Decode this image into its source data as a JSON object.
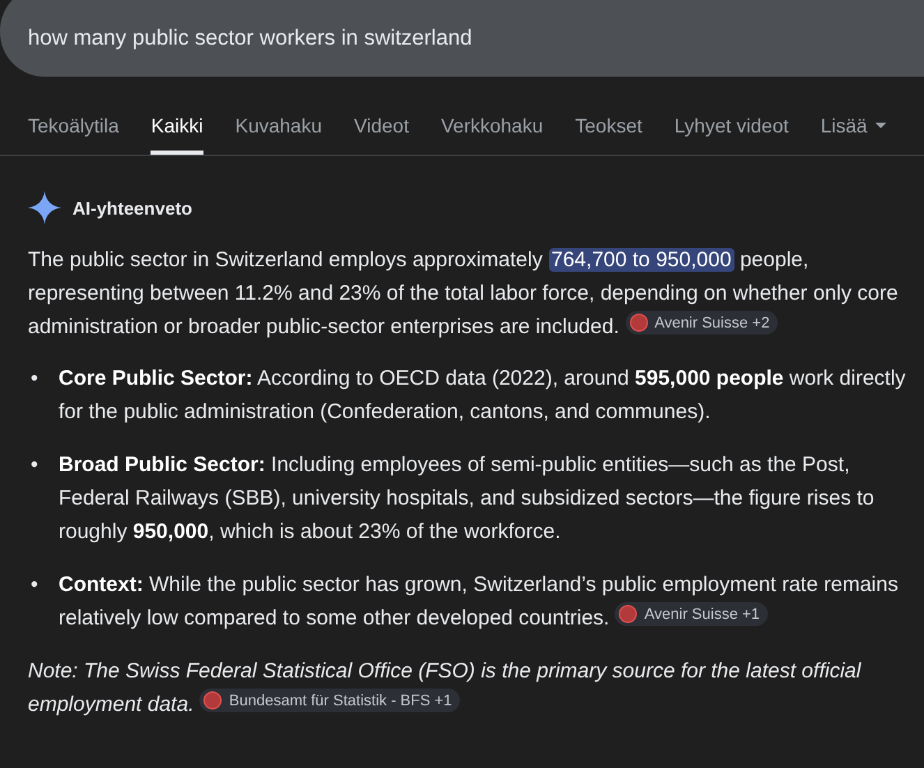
{
  "search": {
    "value": "how many public sector workers in switzerland"
  },
  "tabs": [
    {
      "label": "Tekoälytila",
      "selected": false
    },
    {
      "label": "Kaikki",
      "selected": true
    },
    {
      "label": "Kuvahaku",
      "selected": false
    },
    {
      "label": "Videot",
      "selected": false
    },
    {
      "label": "Verkkohaku",
      "selected": false
    },
    {
      "label": "Teokset",
      "selected": false
    },
    {
      "label": "Lyhyet videot",
      "selected": false
    },
    {
      "label": "Lisää",
      "selected": false,
      "kind": "menu"
    }
  ],
  "overview": {
    "title": "AI-yhteenveto",
    "intro": {
      "before": "The public sector in Switzerland employs approximately ",
      "highlight": "764,700 to 950,000",
      "after": " people, representing between 11.2% and 23% of the total labor force, depending on whether only core administration or broader public-sector enterprises are included.",
      "source": "Avenir Suisse +2"
    },
    "bullets": [
      {
        "marker": "•",
        "label": "Core Public Sector:",
        "text": " According to OECD data (2022), around **595,000 people** work directly for the public administration (Confederation, cantons, and communes)."
      },
      {
        "marker": "•",
        "label": "Broad Public Sector:",
        "text": " Including employees of semi-public entities—such as the Post, Federal Railways (SBB), university hospitals, and subsidized sectors—the figure rises to roughly **950,000**, which is about 23% of the workforce."
      },
      {
        "marker": "•",
        "label": "Context:",
        "text": " While the public sector has grown, Switzerland’s public employment rate remains relatively low compared to some other developed countries.",
        "source": "Avenir Suisse +1"
      }
    ],
    "note": {
      "text": "Note: The Swiss Federal Statistical Office (FSO) is the primary source for the latest official employment data.",
      "source": "Bundesamt für Statistik - BFS +1"
    }
  }
}
